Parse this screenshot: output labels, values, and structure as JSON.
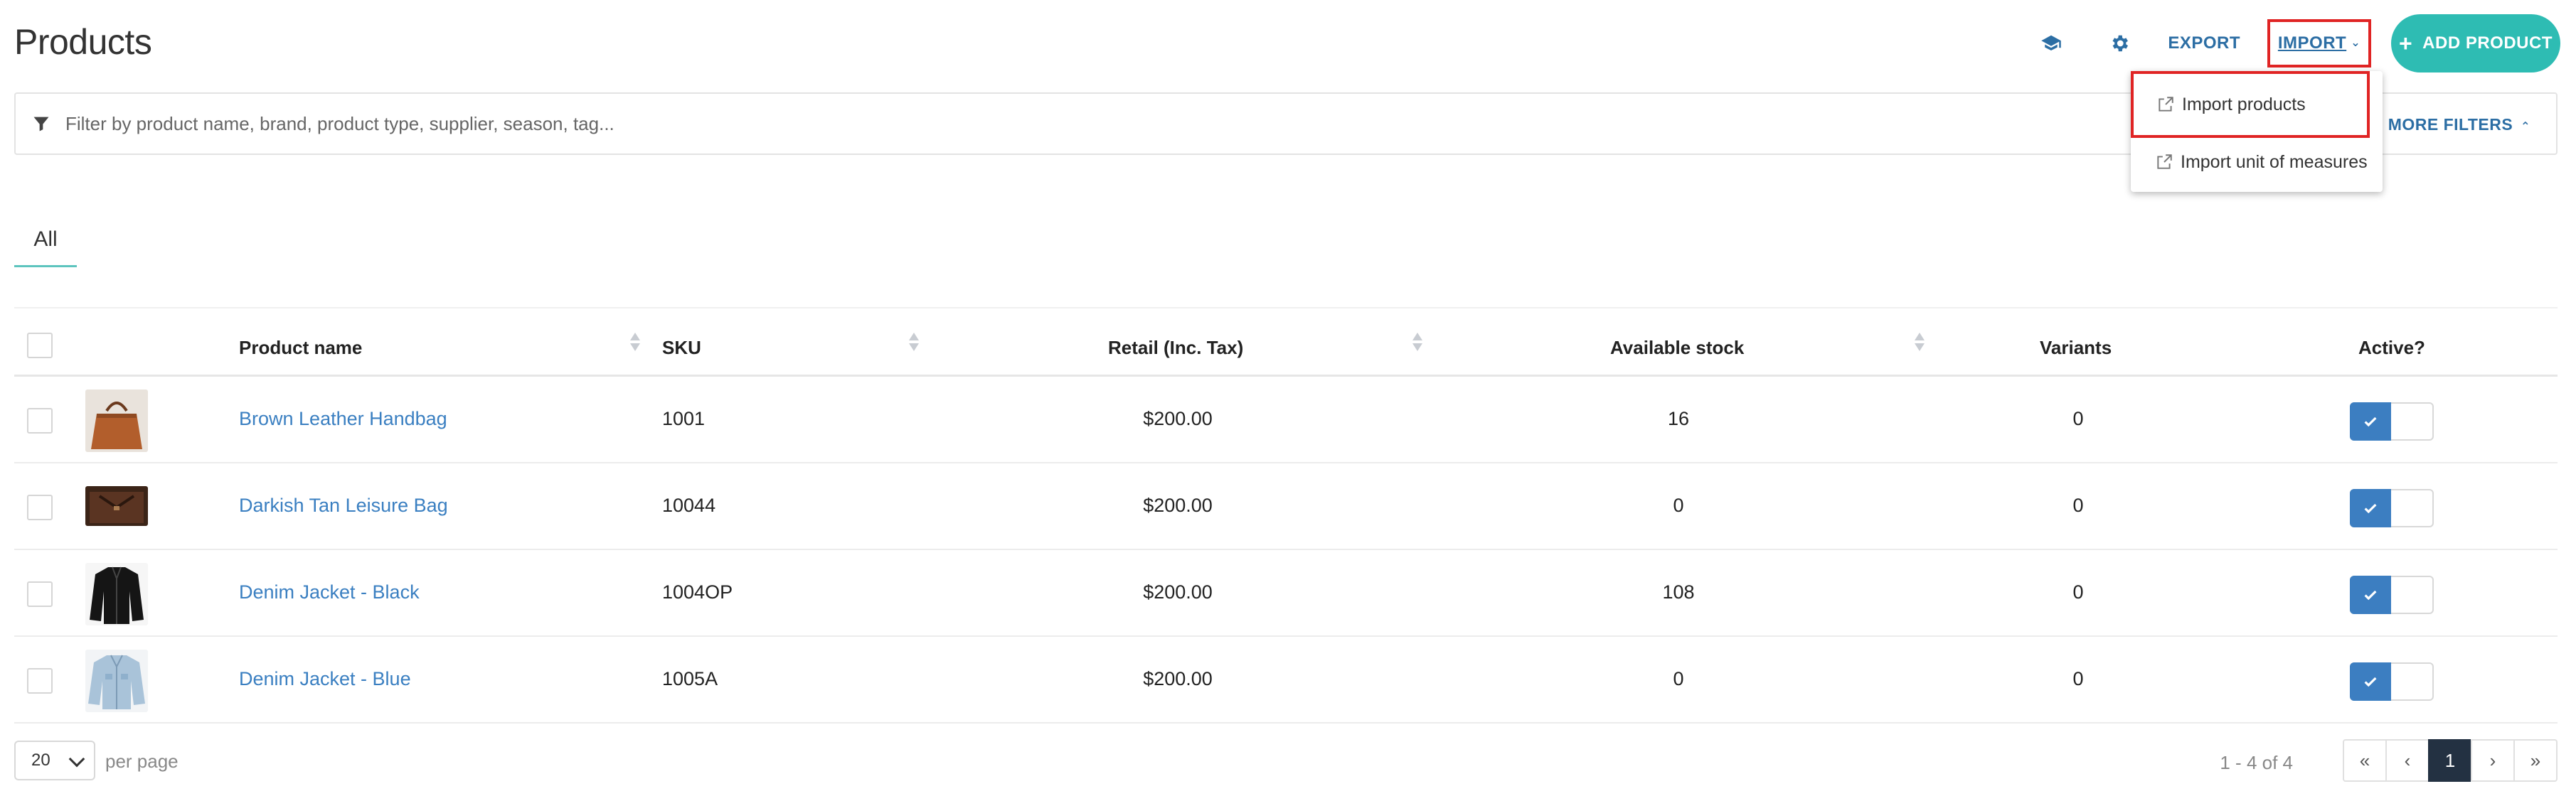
{
  "page": {
    "title": "Products"
  },
  "header": {
    "help_icon": "graduation-cap-icon",
    "settings_icon": "gear-icon",
    "export_label": "EXPORT",
    "import_label": "IMPORT",
    "add_label": "ADD PRODUCT"
  },
  "filter": {
    "placeholder": "Filter by product name, brand, product type, supplier, season, tag...",
    "more_filters_label": "MORE FILTERS"
  },
  "import_menu": {
    "items": [
      {
        "label": "Import products",
        "icon": "external-link-icon"
      },
      {
        "label": "Import unit of measures",
        "icon": "external-link-icon"
      }
    ]
  },
  "tabs": [
    {
      "label": "All"
    }
  ],
  "table": {
    "columns": [
      "Product name",
      "SKU",
      "Retail (Inc. Tax)",
      "Available stock",
      "Variants",
      "Active?"
    ],
    "rows": [
      {
        "name": "Brown Leather Handbag",
        "sku": "1001",
        "retail": "$200.00",
        "stock": "16",
        "variants": "0",
        "active": true,
        "thumb": "handbag"
      },
      {
        "name": "Darkish Tan Leisure Bag",
        "sku": "10044",
        "retail": "$200.00",
        "stock": "0",
        "variants": "0",
        "active": true,
        "thumb": "tan-bag"
      },
      {
        "name": "Denim Jacket - Black",
        "sku": "1004OP",
        "retail": "$200.00",
        "stock": "108",
        "variants": "0",
        "active": true,
        "thumb": "black-jacket"
      },
      {
        "name": "Denim Jacket - Blue",
        "sku": "1005A",
        "retail": "$200.00",
        "stock": "0",
        "variants": "0",
        "active": true,
        "thumb": "blue-jacket"
      }
    ]
  },
  "pagination": {
    "per_page_value": "20",
    "per_page_label": "per page",
    "range_text": "1 - 4 of 4",
    "first": "«",
    "prev": "‹",
    "current": "1",
    "next": "›",
    "last": "»"
  },
  "colors": {
    "accent": "#2ebcb3",
    "link": "#2c6ea4",
    "toggle_on": "#3c7ec1",
    "highlight": "#e02424",
    "pager_active": "#233142"
  }
}
